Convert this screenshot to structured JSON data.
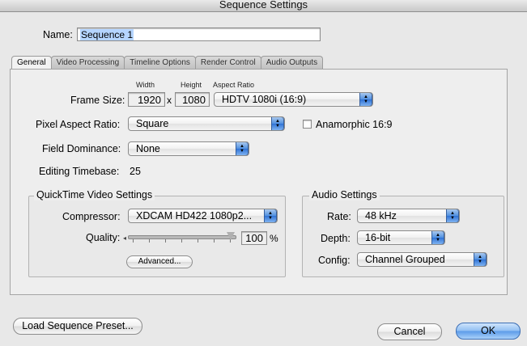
{
  "window": {
    "title": "Sequence Settings"
  },
  "name": {
    "label": "Name:",
    "value": "Sequence 1"
  },
  "tabs": [
    {
      "label": "General",
      "active": true
    },
    {
      "label": "Video Processing",
      "active": false
    },
    {
      "label": "Timeline Options",
      "active": false
    },
    {
      "label": "Render Control",
      "active": false
    },
    {
      "label": "Audio Outputs",
      "active": false
    }
  ],
  "general": {
    "frame_size": {
      "label": "Frame Size:",
      "width_header": "Width",
      "height_header": "Height",
      "aspect_header": "Aspect Ratio",
      "width": "1920",
      "times": "x",
      "height": "1080",
      "aspect_ratio": "HDTV 1080i (16:9)"
    },
    "pixel_aspect": {
      "label": "Pixel Aspect Ratio:",
      "value": "Square"
    },
    "anamorphic": {
      "label": "Anamorphic 16:9",
      "checked": false
    },
    "field_dominance": {
      "label": "Field Dominance:",
      "value": "None"
    },
    "timebase": {
      "label": "Editing Timebase:",
      "value": "25"
    }
  },
  "quicktime": {
    "title": "QuickTime Video Settings",
    "compressor_label": "Compressor:",
    "compressor_value": "XDCAM HD422 1080p2...",
    "quality_label": "Quality:",
    "quality_value": "100",
    "quality_unit": "%",
    "quality_fraction": 1.0,
    "advanced_label": "Advanced..."
  },
  "audio": {
    "title": "Audio Settings",
    "rate_label": "Rate:",
    "rate_value": "48 kHz",
    "depth_label": "Depth:",
    "depth_value": "16-bit",
    "config_label": "Config:",
    "config_value": "Channel Grouped"
  },
  "buttons": {
    "load_preset": "Load Sequence Preset...",
    "cancel": "Cancel",
    "ok": "OK"
  }
}
